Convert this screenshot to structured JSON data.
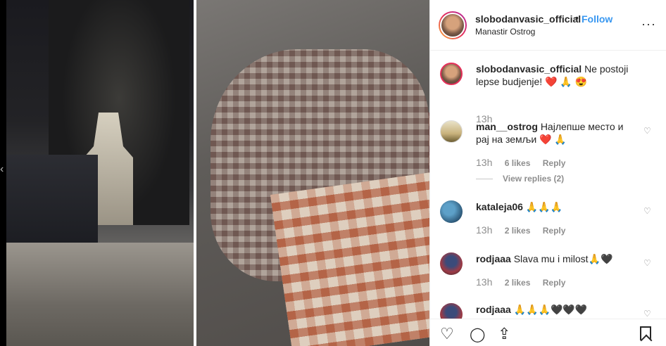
{
  "post": {
    "username": "slobodanvasic_official",
    "separator": "•",
    "follow_label": "Follow",
    "location": "Manastir Ostrog",
    "more_icon": "more-options-icon",
    "more_glyph": "···"
  },
  "caption": {
    "username": "slobodanvasic_official",
    "text": "Ne postoji lepse budjenje!",
    "emojis": "❤️ 🙏 😍",
    "time": "13h"
  },
  "comments": [
    {
      "username": "man__ostrog",
      "text": "Најлепше место и рај на земљи",
      "emojis": "❤️ 🙏",
      "time": "13h",
      "likes": "6 likes",
      "reply": "Reply",
      "view_replies": "View replies (2)"
    },
    {
      "username": "kataleja06",
      "text": "🙏🙏🙏",
      "time": "13h",
      "likes": "2 likes",
      "reply": "Reply"
    },
    {
      "username": "rodjaaa",
      "text": "Slava mu i milost🙏🖤",
      "time": "13h",
      "likes": "2 likes",
      "reply": "Reply"
    },
    {
      "username": "rodjaaa",
      "text": "🙏🙏🙏🖤🖤🖤"
    }
  ],
  "actions": {
    "like_icon": "heart-outline-icon",
    "comment_icon": "comment-bubble-icon",
    "share_icon": "share-icon",
    "save_icon": "bookmark-icon"
  },
  "colors": {
    "link": "#3897f0",
    "text": "#262626",
    "muted": "#8e8e8e"
  }
}
